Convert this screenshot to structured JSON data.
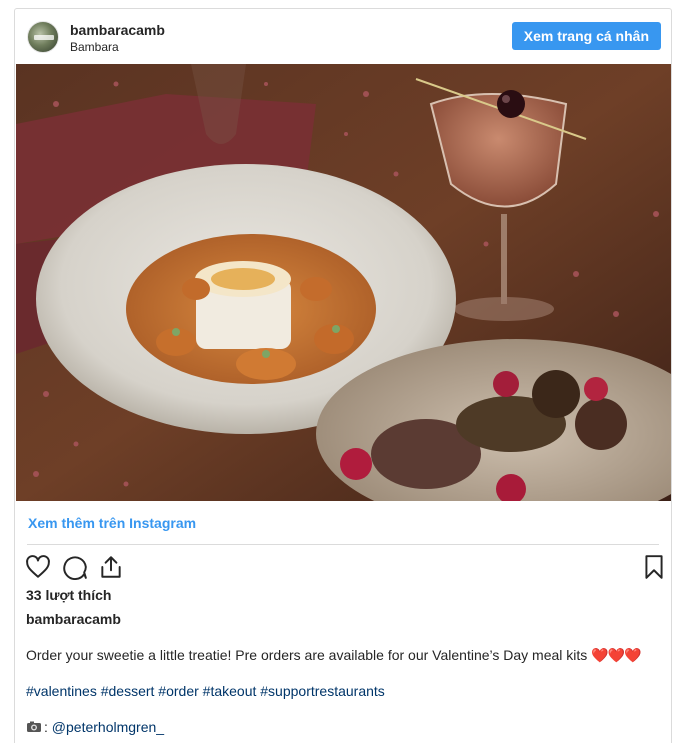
{
  "header": {
    "username": "bambaracamb",
    "fullname": "Bambara",
    "profile_button": "Xem trang cá nhân"
  },
  "post": {
    "photo_icon": "dessert-photo",
    "view_more": "Xem thêm trên Instagram",
    "likes": "33 lượt thích",
    "owner": "bambaracamb",
    "caption": "Order your sweetie a little treatie! Pre orders are available for our Valentine’s Day meal kits",
    "caption_emoji": "❤️❤️❤️",
    "hashtags": "#valentines #dessert #order #takeout #supportrestaurants",
    "credit_prefix": ": ",
    "credit_handle": "@peterholmgren_"
  },
  "icons": {
    "like": "heart-icon",
    "comment": "comment-icon",
    "share": "share-icon",
    "save": "bookmark-icon",
    "credit": "camera-icon"
  },
  "colors": {
    "accent": "#3897f0",
    "link": "#003569",
    "border": "#dbdbdb"
  }
}
